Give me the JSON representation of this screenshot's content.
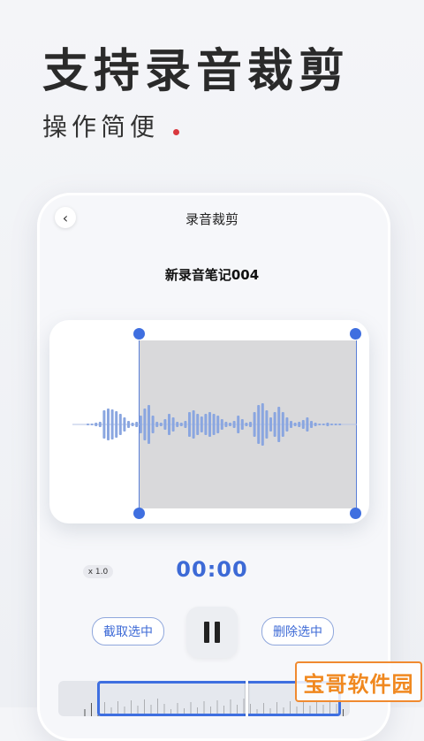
{
  "promo": {
    "headline": "支持录音裁剪",
    "subline": "操作简便"
  },
  "screen": {
    "title": "录音裁剪",
    "record_name": "新录音笔记004",
    "back_icon": "‹"
  },
  "player": {
    "speed": "x 1.0",
    "time": "00:00",
    "cut_label": "截取选中",
    "delete_label": "删除选中"
  },
  "watermark": "宝哥软件园",
  "colors": {
    "accent": "#3d6ad6",
    "handle": "#3f6fe0",
    "selection": "#d9d9db",
    "wave": "#8aa6e0",
    "highlight_dot": "#d9383e"
  }
}
